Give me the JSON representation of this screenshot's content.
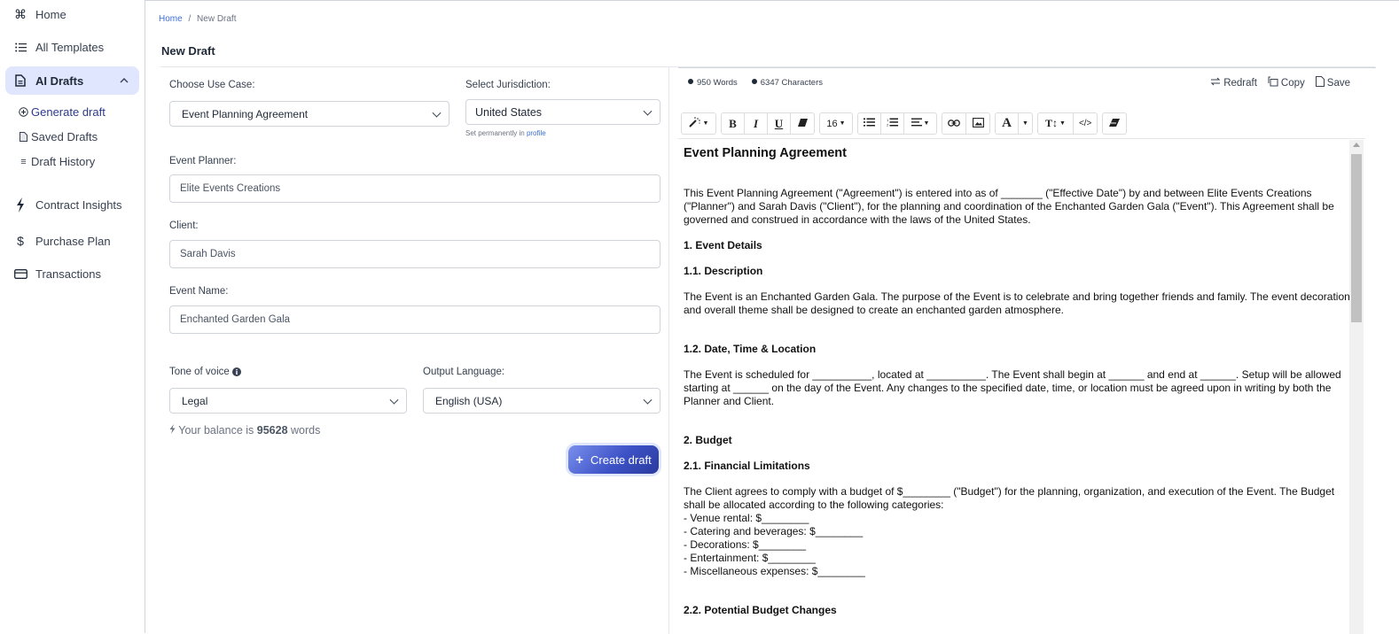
{
  "sidebar": {
    "items": [
      {
        "label": "Home",
        "icon": "command-icon"
      },
      {
        "label": "All Templates",
        "icon": "list-icon"
      },
      {
        "label": "AI Drafts",
        "icon": "document-icon",
        "expanded": true
      },
      {
        "label": "Contract Insights",
        "icon": "lightning-icon"
      },
      {
        "label": "Purchase Plan",
        "icon": "dollar-icon"
      },
      {
        "label": "Transactions",
        "icon": "card-icon"
      }
    ],
    "subitems": [
      {
        "label": "Generate draft",
        "icon": "plus-circle-icon",
        "active": true
      },
      {
        "label": "Saved Drafts",
        "icon": "file-icon"
      },
      {
        "label": "Draft History",
        "icon": "menu-icon"
      }
    ]
  },
  "breadcrumb": {
    "home": "Home",
    "separator": "/",
    "current": "New Draft"
  },
  "page_title": "New Draft",
  "form": {
    "use_case": {
      "label": "Choose Use Case:",
      "value": "Event Planning Agreement"
    },
    "jurisdiction": {
      "label": "Select Jurisdiction:",
      "value": "United States",
      "hint_prefix": "Set permanently in",
      "hint_link": "profile"
    },
    "event_planner": {
      "label": "Event Planner:",
      "value": "Elite Events Creations"
    },
    "client": {
      "label": "Client:",
      "value": "Sarah Davis"
    },
    "event_name": {
      "label": "Event Name:",
      "value": "Enchanted Garden Gala"
    },
    "tone": {
      "label": "Tone of voice",
      "value": "Legal"
    },
    "language": {
      "label": "Output Language:",
      "value": "English (USA)"
    },
    "balance": {
      "prefix": "Your balance is",
      "amount": "95628",
      "suffix": "words"
    },
    "create_button": "Create draft"
  },
  "editor": {
    "stats": {
      "words": "950 Words",
      "characters": "6347 Characters"
    },
    "actions": {
      "redraft": "Redraft",
      "copy": "Copy",
      "save": "Save"
    },
    "font_size": "16",
    "document": {
      "title": "Event Planning Agreement",
      "intro": "This Event Planning Agreement (\"Agreement\") is entered into as of _______ (\"Effective Date\") by and between Elite Events Creations (\"Planner\") and Sarah Davis (\"Client\"), for the planning and coordination of the Enchanted Garden Gala (\"Event\"). This Agreement shall be governed and construed in accordance with the laws of the United States.",
      "s1": "1. Event Details",
      "s1_1": "1.1. Description",
      "s1_1_text": "The Event is an Enchanted Garden Gala. The purpose of the Event is to celebrate and bring together friends and family. The event decorations and overall theme shall be designed to create an enchanted garden atmosphere.",
      "s1_2": "1.2. Date, Time & Location",
      "s1_2_text": "The Event is scheduled for __________, located at __________. The Event shall begin at ______ and end at ______. Setup will be allowed starting at ______ on the day of the Event. Any changes to the specified date, time, or location must be agreed upon in writing by both the Planner and Client.",
      "s2": "2. Budget",
      "s2_1": "2.1. Financial Limitations",
      "s2_1_text": "The Client agrees to comply with a budget of $________ (\"Budget\") for the planning, organization, and execution of the Event. The Budget shall be allocated according to the following categories:",
      "budget_items": [
        "- Venue rental: $________",
        "- Catering and beverages: $________",
        "- Decorations: $________",
        "- Entertainment: $________",
        "- Miscellaneous expenses: $________"
      ],
      "s2_2": "2.2. Potential Budget Changes"
    }
  }
}
